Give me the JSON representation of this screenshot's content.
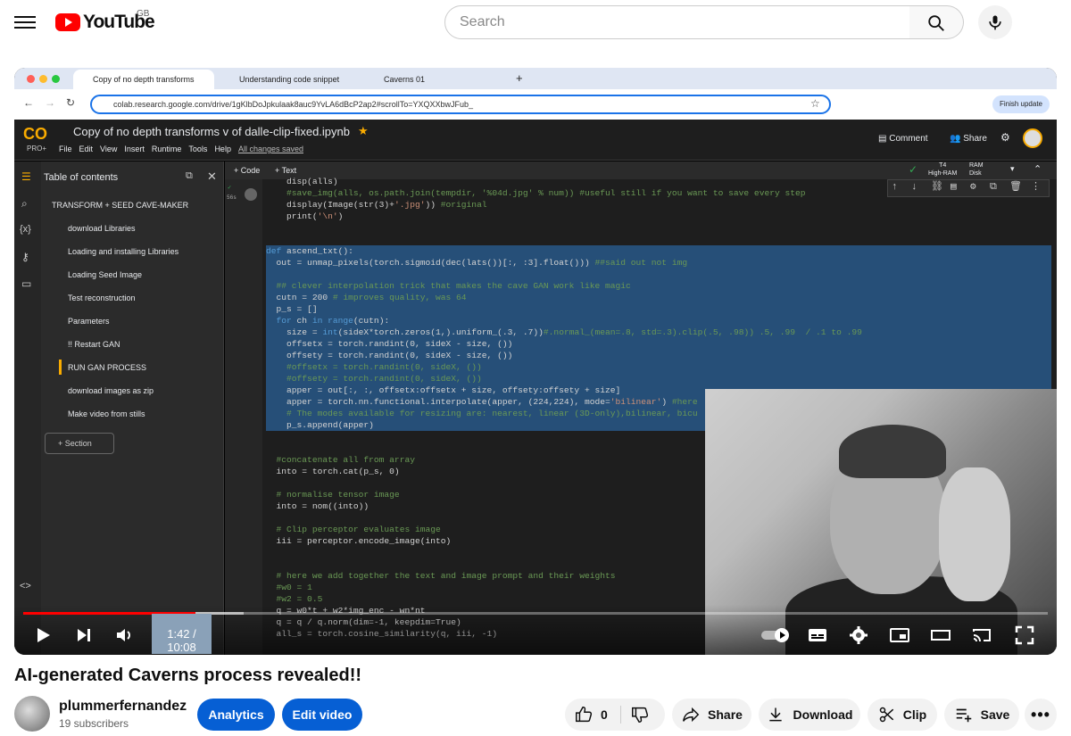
{
  "youtube": {
    "region": "GB",
    "logo_text": "YouTube",
    "search_placeholder": "Search",
    "video_title": "AI-generated Caverns process revealed!!",
    "channel_name": "plummerfernandez",
    "subscribers": "19 subscribers",
    "buttons": {
      "analytics": "Analytics",
      "edit_video": "Edit video",
      "like_count": "0",
      "share": "Share",
      "download": "Download",
      "clip": "Clip",
      "save": "Save"
    },
    "player": {
      "time": "1:42 / 10:08",
      "progress_fraction": 0.168,
      "buffered_fraction": 0.215
    }
  },
  "browser": {
    "tabs": [
      {
        "label": "Copy of no depth transforms"
      },
      {
        "label": "Understanding code snippet"
      },
      {
        "label": "Caverns 01"
      }
    ],
    "url": "colab.research.google.com/drive/1gKlbDoJpkulaak8auc9YvLA6dBcP2ap2#scrollTo=YXQXXbwJFub_",
    "finish_update": "Finish update"
  },
  "colab": {
    "logo": "CO",
    "tier": "PRO+",
    "notebook_title": "Copy of no depth transforms v of dalle-clip-fixed.ipynb",
    "menu": [
      "File",
      "Edit",
      "View",
      "Insert",
      "Runtime",
      "Tools",
      "Help"
    ],
    "saved_status": "All changes saved",
    "comment": "Comment",
    "share": "Share",
    "runtime": {
      "gpu": "T4",
      "mem": "High-RAM",
      "ram": "RAM",
      "disk": "Disk"
    },
    "add_code": "+ Code",
    "add_text": "+ Text",
    "toc_title": "Table of contents",
    "toc": [
      {
        "label": "TRANSFORM + SEED CAVE-MAKER",
        "level": 1
      },
      {
        "label": "download Libraries",
        "level": 2
      },
      {
        "label": "Loading and installing Libraries",
        "level": 2
      },
      {
        "label": "Loading Seed Image",
        "level": 2
      },
      {
        "label": "Test reconstruction",
        "level": 2
      },
      {
        "label": "Parameters",
        "level": 2
      },
      {
        "label": "!! Restart GAN",
        "level": 2
      },
      {
        "label": "RUN GAN PROCESS",
        "level": 2
      },
      {
        "label": "download images as zip",
        "level": 2
      },
      {
        "label": "Make video from stills",
        "level": 2
      }
    ],
    "section_button": "+ Section",
    "cell_exec": "56s",
    "code_lines": [
      "    disp(alls)",
      "    #save_img(alls, os.path.join(tempdir, '%04d.jpg' % num)) #useful still if you want to save every step",
      "    display(Image(str(3)+'.jpg')) #original",
      "    print('\\n')",
      "",
      "",
      "def ascend_txt():",
      "  out = unmap_pixels(torch.sigmoid(dec(lats())[:, :3].float())) ##said out not img",
      "",
      "  ## clever interpolation trick that makes the cave GAN work like magic",
      "  cutn = 200 # improves quality, was 64",
      "  p_s = []",
      "  for ch in range(cutn):",
      "    size = int(sideX*torch.zeros(1,).uniform_(.3, .7))#.normal_(mean=.8, std=.3).clip(.5, .98)) .5, .99  / .1 to .99",
      "    offsetx = torch.randint(0, sideX - size, ())",
      "    offsety = torch.randint(0, sideX - size, ())",
      "    #offsetx = torch.randint(0, sideX, ())",
      "    #offsety = torch.randint(0, sideX, ())",
      "    apper = out[:, :, offsetx:offsetx + size, offsety:offsety + size]",
      "    apper = torch.nn.functional.interpolate(apper, (224,224), mode='bilinear') #here",
      "    # The modes available for resizing are: nearest, linear (3D-only),bilinear, bicu",
      "    p_s.append(apper)",
      "",
      "",
      "  #concatenate all from array",
      "  into = torch.cat(p_s, 0)",
      "",
      "  # normalise tensor image",
      "  into = nom((into))",
      "",
      "  # Clip perceptor evaluates image",
      "  iii = perceptor.encode_image(into)",
      "",
      "",
      "  # here we add together the text and image prompt and their weights",
      "  #w0 = 1",
      "  #w2 = 0.5",
      "  q = w0*t + w2*img_enc - wn*nt",
      "  q = q / q.norm(dim=-1, keepdim=True)",
      "  all_s = torch.cosine_similarity(q, iii, -1)"
    ]
  }
}
